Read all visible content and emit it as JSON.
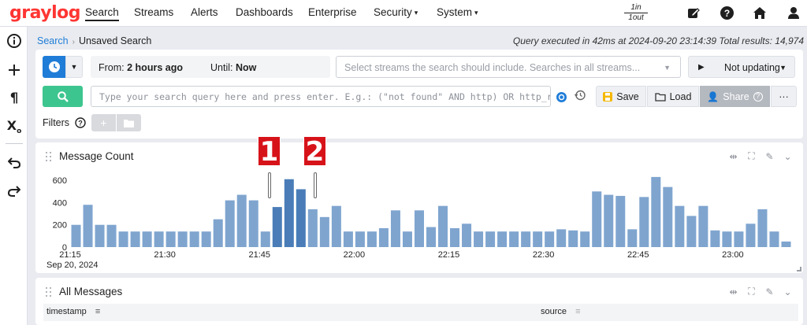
{
  "app": {
    "logo": "graylog"
  },
  "nav": {
    "items": [
      {
        "label": "Search",
        "active": true
      },
      {
        "label": "Streams"
      },
      {
        "label": "Alerts"
      },
      {
        "label": "Dashboards"
      },
      {
        "label": "Enterprise"
      },
      {
        "label": "Security",
        "caret": "▾"
      },
      {
        "label": "System",
        "caret": "▾"
      }
    ],
    "throughput": {
      "top": "1in",
      "bottom": "1out"
    },
    "icons": [
      "edit-icon",
      "help-icon",
      "home-icon",
      "user-icon"
    ]
  },
  "rail": {
    "icons": [
      "info-icon",
      "plus-icon",
      "paragraph-icon",
      "subscript-icon",
      "undo-icon",
      "redo-icon"
    ]
  },
  "breadcrumb": {
    "root": "Search",
    "current": "Unsaved Search"
  },
  "query_info": "Query executed in 42ms at 2024-09-20 23:14:39 Total results: 14,974",
  "search": {
    "from_label": "From:",
    "from_value": "2 hours ago",
    "until_label": "Until:",
    "until_value": "Now",
    "streams_placeholder": "Select streams the search should include. Searches in all streams...",
    "refresh_label": "Not updating",
    "query_placeholder": "Type your search query here and press enter. E.g.: (\"not found\" AND http) OR http_res...",
    "save_label": "Save",
    "load_label": "Load",
    "share_label": "Share",
    "more_label": "···",
    "filters_label": "Filters"
  },
  "message_count": {
    "title": "Message Count",
    "markers": [
      "1",
      "2"
    ]
  },
  "all_messages": {
    "title": "All Messages",
    "columns": [
      "timestamp",
      "source"
    ]
  },
  "colors": {
    "accent": "#1f7dd8",
    "go": "#3dc58f",
    "bar": "#7fa5cf",
    "bar_highlight": "#4a7db8",
    "marker": "#d7131a"
  },
  "chart_data": {
    "type": "bar",
    "title": "Message Count",
    "xlabel": "",
    "ylabel": "",
    "ylim": [
      0,
      700
    ],
    "yticks": [
      0,
      200,
      400,
      600
    ],
    "xticks": [
      "21:15",
      "21:30",
      "21:45",
      "22:00",
      "22:15",
      "22:30",
      "22:45",
      "23:00"
    ],
    "x_sublabel": "Sep 20, 2024",
    "highlight_range": [
      17,
      20
    ],
    "values": [
      200,
      380,
      200,
      200,
      140,
      140,
      140,
      140,
      140,
      140,
      140,
      140,
      250,
      420,
      470,
      420,
      140,
      360,
      610,
      520,
      340,
      270,
      370,
      140,
      140,
      140,
      170,
      330,
      140,
      330,
      180,
      370,
      170,
      210,
      140,
      140,
      140,
      140,
      140,
      140,
      140,
      160,
      150,
      140,
      500,
      470,
      460,
      160,
      450,
      630,
      540,
      370,
      280,
      370,
      150,
      140,
      140,
      210,
      340,
      140,
      50
    ]
  }
}
